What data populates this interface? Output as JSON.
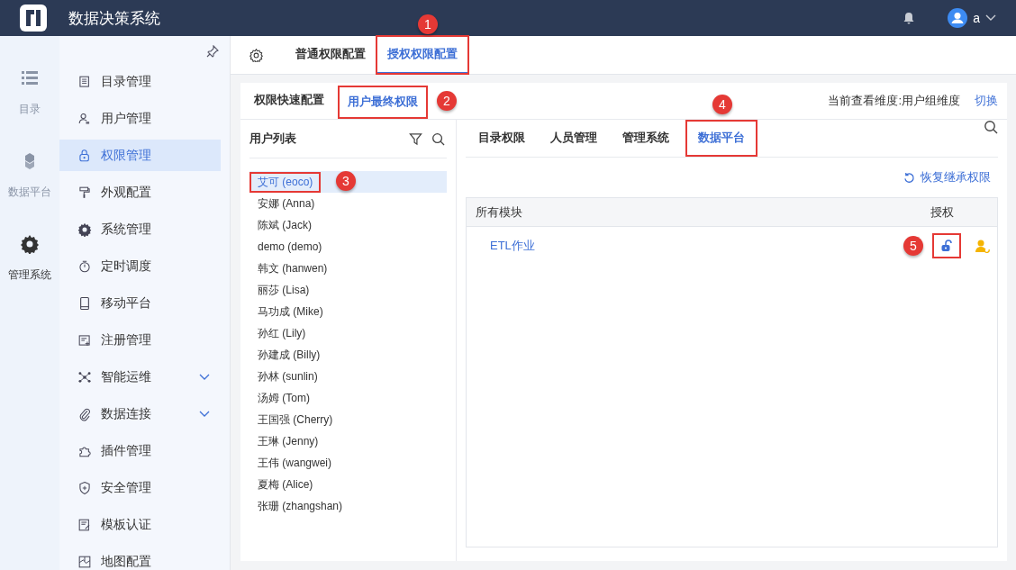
{
  "header": {
    "title": "数据决策系统",
    "user": "a"
  },
  "rail": [
    {
      "label": "目录",
      "kind": "list",
      "selected": false
    },
    {
      "label": "数据平台",
      "kind": "cubes",
      "selected": false
    },
    {
      "label": "管理系统",
      "kind": "gear",
      "selected": true
    }
  ],
  "sidebar": {
    "items": [
      {
        "label": "目录管理",
        "kind": "doc",
        "expandable": false,
        "selected": false
      },
      {
        "label": "用户管理",
        "kind": "user",
        "expandable": false,
        "selected": false
      },
      {
        "label": "权限管理",
        "kind": "lock",
        "expandable": false,
        "selected": true
      },
      {
        "label": "外观配置",
        "kind": "brush",
        "expandable": false,
        "selected": false
      },
      {
        "label": "系统管理",
        "kind": "gear",
        "expandable": false,
        "selected": false
      },
      {
        "label": "定时调度",
        "kind": "timer",
        "expandable": false,
        "selected": false
      },
      {
        "label": "移动平台",
        "kind": "mobile",
        "expandable": false,
        "selected": false
      },
      {
        "label": "注册管理",
        "kind": "register",
        "expandable": false,
        "selected": false
      },
      {
        "label": "智能运维",
        "kind": "network",
        "expandable": true,
        "selected": false
      },
      {
        "label": "数据连接",
        "kind": "clip",
        "expandable": true,
        "selected": false
      },
      {
        "label": "插件管理",
        "kind": "puzzle",
        "expandable": false,
        "selected": false
      },
      {
        "label": "安全管理",
        "kind": "shield",
        "expandable": false,
        "selected": false
      },
      {
        "label": "模板认证",
        "kind": "template",
        "expandable": false,
        "selected": false
      },
      {
        "label": "地图配置",
        "kind": "map",
        "expandable": false,
        "selected": false
      }
    ]
  },
  "top_tabs": [
    {
      "label": "普通权限配置",
      "selected": false
    },
    {
      "label": "授权权限配置",
      "selected": true,
      "callout": "1"
    }
  ],
  "sub_tabs": [
    {
      "label": "权限快速配置",
      "selected": false
    },
    {
      "label": "用户最终权限",
      "selected": true,
      "callout": "2"
    }
  ],
  "dimension": {
    "text": "当前查看维度:用户组维度",
    "link": "切换"
  },
  "user_list": {
    "title": "用户列表",
    "users": [
      {
        "name": "艾可 (eoco)",
        "selected": true,
        "callout": "3"
      },
      {
        "name": "安娜 (Anna)",
        "selected": false
      },
      {
        "name": "陈斌 (Jack)",
        "selected": false
      },
      {
        "name": "demo (demo)",
        "selected": false
      },
      {
        "name": "韩文 (hanwen)",
        "selected": false
      },
      {
        "name": "丽莎 (Lisa)",
        "selected": false
      },
      {
        "name": "马功成 (Mike)",
        "selected": false
      },
      {
        "name": "孙红 (Lily)",
        "selected": false
      },
      {
        "name": "孙建成 (Billy)",
        "selected": false
      },
      {
        "name": "孙林 (sunlin)",
        "selected": false
      },
      {
        "name": "汤姆 (Tom)",
        "selected": false
      },
      {
        "name": "王国强 (Cherry)",
        "selected": false
      },
      {
        "name": "王琳 (Jenny)",
        "selected": false
      },
      {
        "name": "王伟 (wangwei)",
        "selected": false
      },
      {
        "name": "夏梅 (Alice)",
        "selected": false
      },
      {
        "name": "张珊 (zhangshan)",
        "selected": false
      }
    ]
  },
  "module_tabs": [
    {
      "label": "目录权限",
      "selected": false
    },
    {
      "label": "人员管理",
      "selected": false
    },
    {
      "label": "管理系统",
      "selected": false
    },
    {
      "label": "数据平台",
      "selected": true,
      "callout": "4"
    }
  ],
  "restore_link": "恢复继承权限",
  "table": {
    "columns": [
      "所有模块",
      "授权"
    ],
    "rows": [
      {
        "module": "ETL作业",
        "callout": "5"
      }
    ]
  }
}
